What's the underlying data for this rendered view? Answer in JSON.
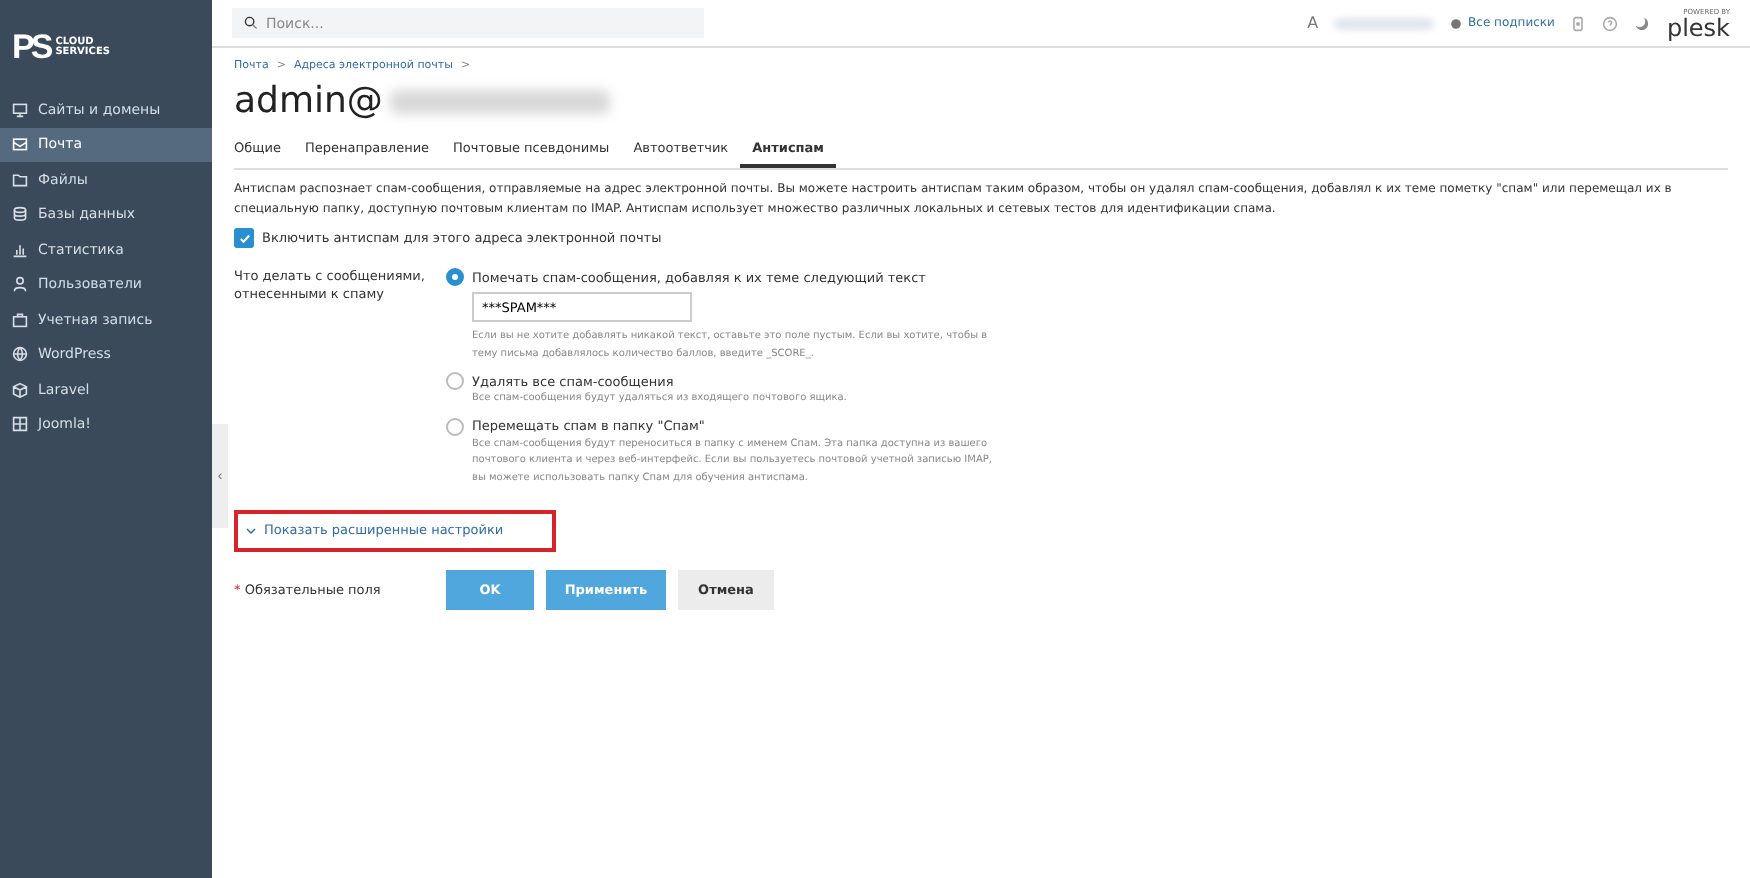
{
  "sidebar": {
    "logo": {
      "mark": "PS",
      "line1": "CLOUD",
      "line2": "SERVICES"
    },
    "items": [
      {
        "label": "Сайты и домены",
        "selected": false
      },
      {
        "label": "Почта",
        "selected": true
      },
      {
        "label": "Файлы",
        "selected": false
      },
      {
        "label": "Базы данных",
        "selected": false
      },
      {
        "label": "Статистика",
        "selected": false
      },
      {
        "label": "Пользователи",
        "selected": false
      },
      {
        "label": "Учетная запись",
        "selected": false
      },
      {
        "label": "WordPress",
        "selected": false
      },
      {
        "label": "Laravel",
        "selected": false
      },
      {
        "label": "Joomla!",
        "selected": false
      }
    ],
    "collapse_toggle": "‹"
  },
  "header": {
    "search": {
      "placeholder": "Поиск..."
    },
    "user_initial": "A",
    "subscriptions": "Все подписки",
    "brand": {
      "tagline": "POWERED BY",
      "name": "plesk"
    }
  },
  "breadcrumbs": [
    {
      "kind": "link",
      "text": "Почта"
    },
    {
      "kind": "separator",
      "text": ">"
    },
    {
      "kind": "link",
      "text": "Адреса электронной почты"
    },
    {
      "kind": "separator",
      "text": ">"
    }
  ],
  "title": "admin@",
  "tabs": [
    {
      "label": "Общие",
      "selected": false
    },
    {
      "label": "Перенаправление",
      "selected": false
    },
    {
      "label": "Почтовые псевдонимы",
      "selected": false
    },
    {
      "label": "Автоответчик",
      "selected": false
    },
    {
      "label": "Антиспам",
      "selected": true
    }
  ],
  "description": "Антиспам распознает спам-сообщения, отправляемые на адрес электронной почты. Вы можете настроить антиспам таким образом, чтобы он удалял спам-сообщения, добавлял к их теме пометку \"спам\" или перемещал их в специальную папку, доступную почтовым клиентам по IMAP. Антиспам использует множество различных локальных и сетевых тестов для идентификации спама.",
  "enable": {
    "label": "Включить антиспам для этого адреса электронной почты",
    "checked": true
  },
  "spam_action": {
    "label": "Что делать с сообщениями, отнесенными к спаму",
    "options": [
      {
        "label": "Помечать спам-сообщения, добавляя к их теме следующий текст",
        "selected": true,
        "value": "***SPAM***",
        "hint": "Если вы не хотите добавлять никакой текст, оставьте это поле пустым. Если вы хотите, чтобы в тему письма добавлялось количество баллов, введите _SCORE_."
      },
      {
        "label": "Удалять все спам-сообщения",
        "selected": false,
        "hint": "Все спам-сообщения будут удаляться из входящего почтового ящика."
      },
      {
        "label": "Перемещать спам в папку \"Спам\"",
        "selected": false,
        "hint": "Все спам-сообщения будут переноситься в папку с именем Спам. Эта папка доступна из вашего почтового клиента и через веб-интерфейс. Если вы пользуетесь почтовой учетной записью IMAP, вы можете использовать папку Спам для обучения антиспама."
      }
    ]
  },
  "advanced": {
    "label": "Показать расширенные настройки",
    "highlighted": true
  },
  "required_note": {
    "mark": "*",
    "text": "Обязательные поля"
  },
  "buttons": [
    {
      "label": "OK",
      "kind": "primary"
    },
    {
      "label": "Применить",
      "kind": "primary"
    },
    {
      "label": "Отмена",
      "kind": "secondary"
    }
  ]
}
